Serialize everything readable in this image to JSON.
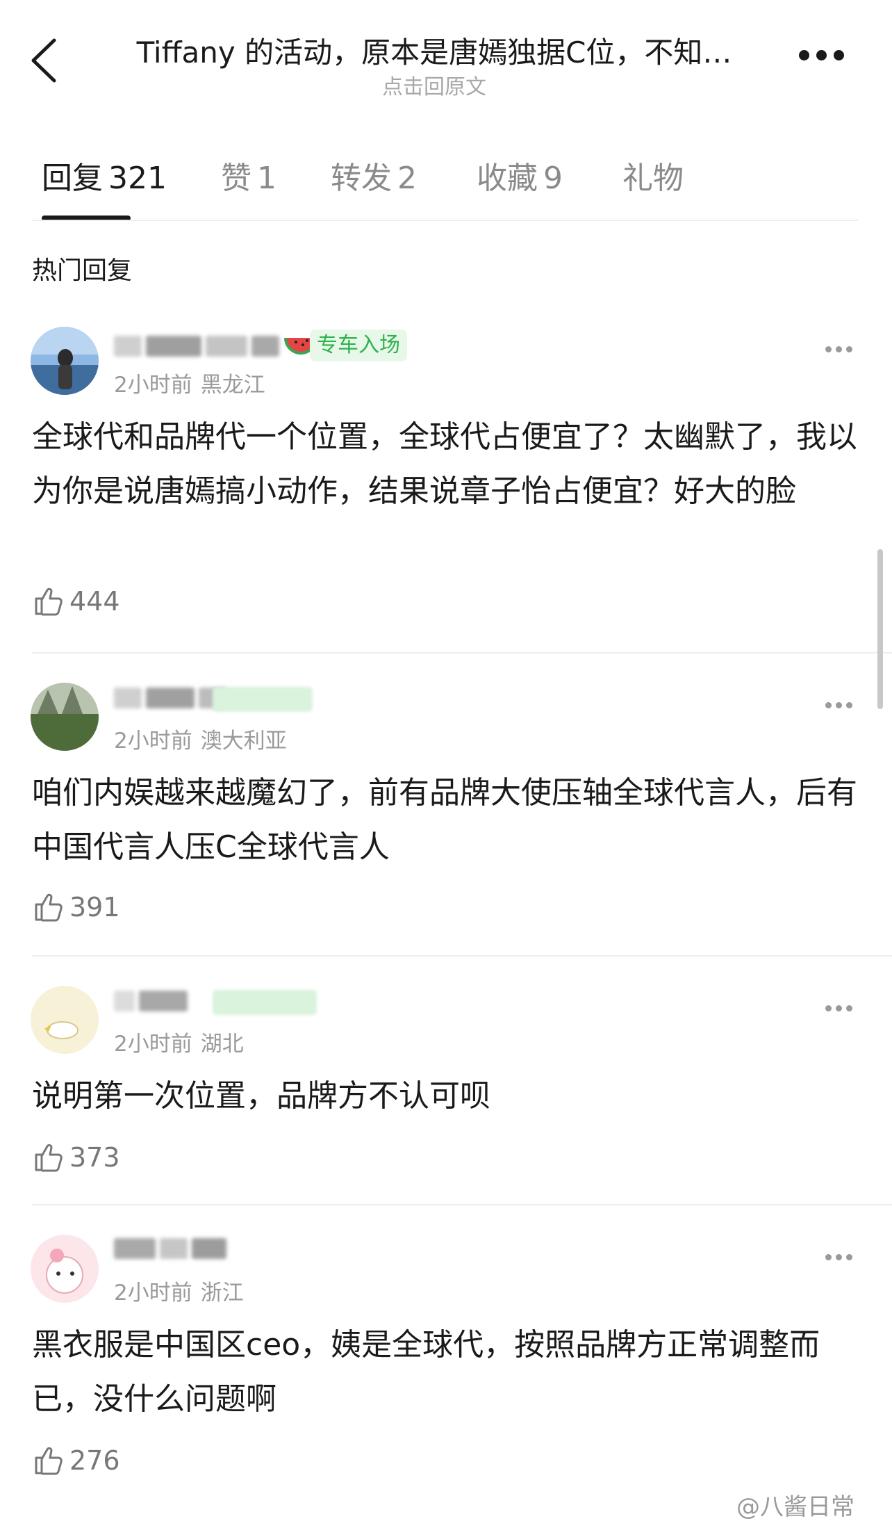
{
  "header": {
    "title": "Tiffany 的活动，原本是唐嫣独据C位，不知…",
    "subtitle": "点击回原文",
    "back_icon": "chevron-left-icon",
    "more_icon": "more-dots-icon"
  },
  "tabs": [
    {
      "label": "回复",
      "count": "321",
      "active": true
    },
    {
      "label": "赞",
      "count": "1",
      "active": false
    },
    {
      "label": "转发",
      "count": "2",
      "active": false
    },
    {
      "label": "收藏",
      "count": "9",
      "active": false
    },
    {
      "label": "礼物",
      "count": "",
      "active": false
    }
  ],
  "section_title": "热门回复",
  "comments": [
    {
      "badge": "专车入场",
      "time": "2小时前",
      "location": "黑龙江",
      "text": "全球代和品牌代一个位置，全球代占便宜了？太幽默了，我以为你是说唐嫣搞小动作，结果说章子怡占便宜？好大的脸",
      "likes": "444"
    },
    {
      "badge": "",
      "time": "2小时前",
      "location": "澳大利亚",
      "text": "咱们内娱越来越魔幻了，前有品牌大使压轴全球代言人，后有中国代言人压C全球代言人",
      "likes": "391"
    },
    {
      "badge": "",
      "time": "2小时前",
      "location": "湖北",
      "text": "说明第一次位置，品牌方不认可呗",
      "likes": "373"
    },
    {
      "badge": "",
      "time": "2小时前",
      "location": "浙江",
      "text": "黑衣服是中国区ceo，姨是全球代，按照品牌方正常调整而已，没什么问题啊",
      "likes": "276"
    }
  ],
  "watermark": "@八酱日常",
  "colors": {
    "badge_green": "#2fb24c",
    "muted": "#9a9a9a",
    "text": "#1a1a1a"
  }
}
